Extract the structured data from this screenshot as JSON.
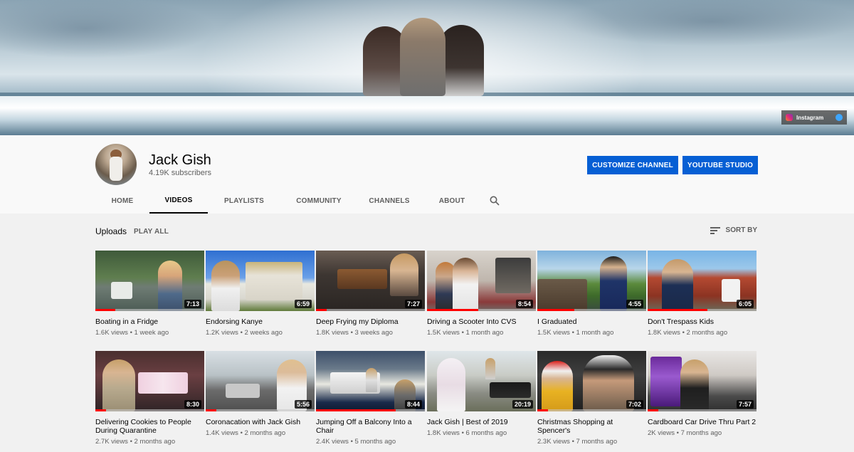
{
  "banner": {
    "instagram_label": "Instagram"
  },
  "channel": {
    "name": "Jack Gish",
    "subscribers": "4.19K subscribers",
    "customize_label": "CUSTOMIZE CHANNEL",
    "studio_label": "YOUTUBE STUDIO"
  },
  "tabs": [
    {
      "label": "HOME"
    },
    {
      "label": "VIDEOS"
    },
    {
      "label": "PLAYLISTS"
    },
    {
      "label": "COMMUNITY"
    },
    {
      "label": "CHANNELS"
    },
    {
      "label": "ABOUT"
    }
  ],
  "active_tab": "VIDEOS",
  "section": {
    "title": "Uploads",
    "play_all": "PLAY ALL",
    "sort_by": "SORT BY"
  },
  "videos": [
    {
      "title": "Boating in a Fridge",
      "views": "1.6K views",
      "age": "1 week ago",
      "duration": "7:13",
      "watched": 0.18
    },
    {
      "title": "Endorsing Kanye",
      "views": "1.2K views",
      "age": "2 weeks ago",
      "duration": "6:59",
      "watched": 0.0
    },
    {
      "title": "Deep Frying my Diploma",
      "views": "1.8K views",
      "age": "3 weeks ago",
      "duration": "7:27",
      "watched": 0.1
    },
    {
      "title": "Driving a Scooter Into CVS",
      "views": "1.5K views",
      "age": "1 month ago",
      "duration": "8:54",
      "watched": 0.47
    },
    {
      "title": "I Graduated",
      "views": "1.5K views",
      "age": "1 month ago",
      "duration": "4:55",
      "watched": 0.34
    },
    {
      "title": "Don't Trespass Kids",
      "views": "1.8K views",
      "age": "2 months ago",
      "duration": "6:05",
      "watched": 0.55
    },
    {
      "title": "Delivering Cookies to People During Quarantine",
      "views": "2.7K views",
      "age": "2 months ago",
      "duration": "8:30",
      "watched": 0.1
    },
    {
      "title": "Coronacation with Jack Gish",
      "views": "1.4K views",
      "age": "2 months ago",
      "duration": "5:56",
      "watched": 0.1
    },
    {
      "title": "Jumping Off a Balcony Into a Chair",
      "views": "2.4K views",
      "age": "5 months ago",
      "duration": "8:44",
      "watched": 0.73
    },
    {
      "title": "Jack Gish | Best of 2019",
      "views": "1.8K views",
      "age": "6 months ago",
      "duration": "20:19",
      "watched": 0.0
    },
    {
      "title": "Christmas Shopping at Spencer's",
      "views": "2.3K views",
      "age": "7 months ago",
      "duration": "7:02",
      "watched": 0.1
    },
    {
      "title": "Cardboard Car Drive Thru Part 2",
      "views": "2K views",
      "age": "7 months ago",
      "duration": "7:57",
      "watched": 0.1
    }
  ]
}
